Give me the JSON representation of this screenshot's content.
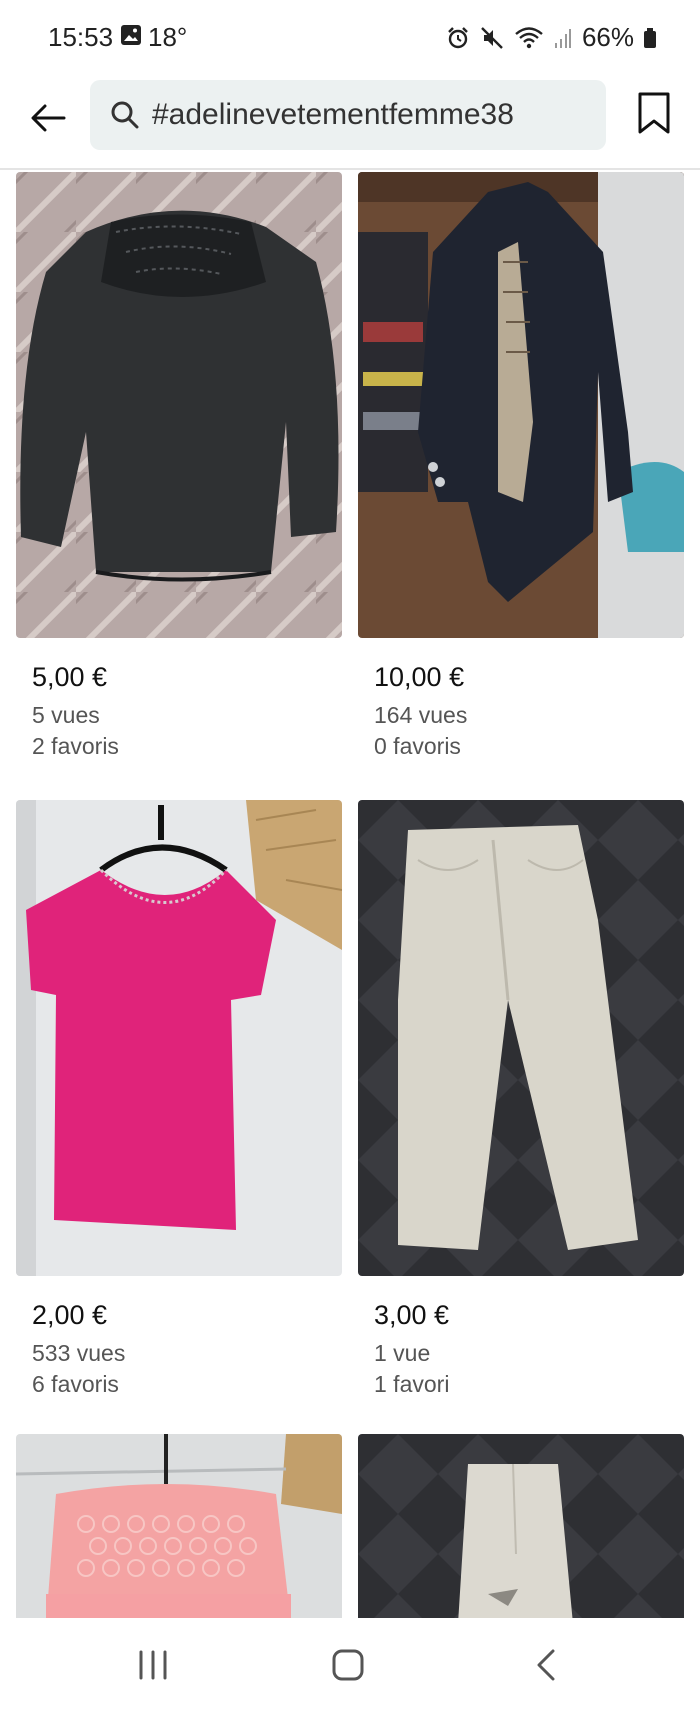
{
  "status_bar": {
    "time": "15:53",
    "temperature": "18°",
    "battery": "66%",
    "icons": [
      "gallery-icon",
      "alarm-icon",
      "mute-icon",
      "wifi-icon",
      "signal-icon",
      "battery-icon"
    ]
  },
  "header": {
    "back_icon": "arrow-left-icon",
    "search_icon": "search-icon",
    "search_value": "#adelinevetementfemme38",
    "bookmark_icon": "bookmark-icon"
  },
  "items": [
    {
      "price": "5,00 €",
      "views": "5 vues",
      "favorites": "2 favoris",
      "photo": "black lace long-sleeve blouse on bed"
    },
    {
      "price": "10,00 €",
      "views": "164 vues",
      "favorites": "0 favoris",
      "photo": "navy trench coat on hanger"
    },
    {
      "price": "2,00 €",
      "views": "533 vues",
      "favorites": "6 favoris",
      "photo": "pink t-shirt on hanger"
    },
    {
      "price": "3,00 €",
      "views": "1 vue",
      "favorites": "1 favori",
      "photo": "beige trousers on dark blanket"
    },
    {
      "price": "",
      "views": "",
      "favorites": "",
      "photo": "pink lace top on hanger"
    },
    {
      "price": "",
      "views": "",
      "favorites": "",
      "photo": "beige jeans on dark blanket"
    }
  ],
  "colors": {
    "search_bg": "#ecf1f1",
    "text_primary": "#111111",
    "text_secondary": "#555555"
  },
  "nav": {
    "icons": [
      "recent-apps-icon",
      "home-icon",
      "back-icon"
    ]
  }
}
